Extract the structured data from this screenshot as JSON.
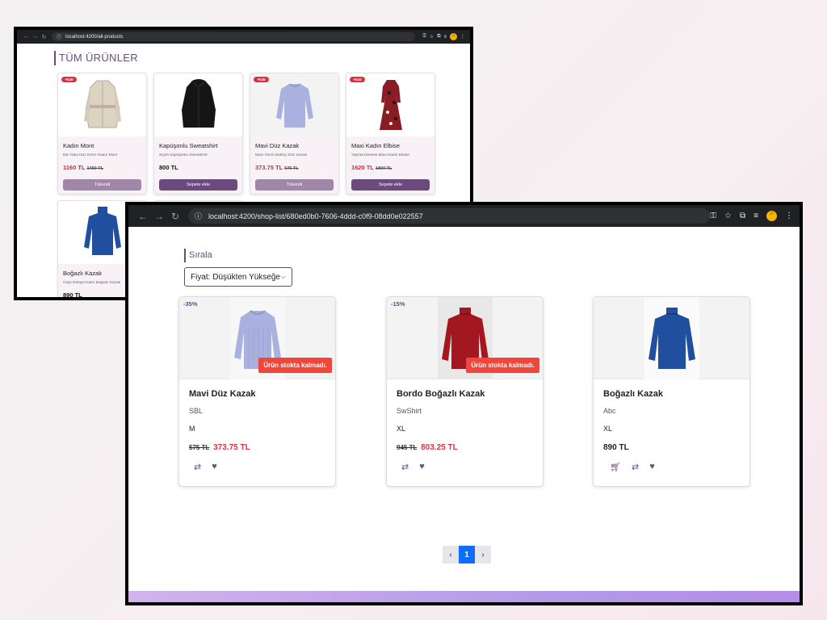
{
  "back_window": {
    "url": "localhost:4200/all-products",
    "heading": "TÜM ÜRÜNLER",
    "products": [
      {
        "badge": "-%20",
        "name": "Kadın Mont",
        "desc": "Dik Yaka Düz Krem Kadın Mont",
        "price": "1160 TL",
        "old_price": "1450 TL",
        "button": "Tükendi",
        "button_state": "out"
      },
      {
        "badge": "",
        "name": "Kapüşonlu Sweatshirt",
        "desc": "Siyah Kapüşonlu Sweatshirt",
        "price": "800 TL",
        "old_price": "",
        "button": "Sepete ekle",
        "button_state": "add"
      },
      {
        "badge": "-%35",
        "name": "Mavi Düz Kazak",
        "desc": "Mavi Yarım Balıkçı Düz Kazak",
        "price": "373.75 TL",
        "old_price": "575 TL",
        "button": "Tükendi",
        "button_state": "out"
      },
      {
        "badge": "-%10",
        "name": "Maxi Kadın Elbise",
        "desc": "Yaprak Desenli Maxi Kadın Elbise",
        "price": "1620 TL",
        "old_price": "1800 TL",
        "button": "Sepete ekle",
        "button_state": "add"
      },
      {
        "badge": "",
        "name": "Boğazlı Kazak",
        "desc": "Örgü Detaylı Kalın Boğazlı Kazak",
        "price": "890 TL",
        "old_price": "",
        "button": "",
        "button_state": ""
      }
    ]
  },
  "front_window": {
    "url": "localhost:4200/shop-list/680ed0b0-7606-4ddd-c0f9-08dd0e022557",
    "sort_label": "Sırala",
    "sort_value": "Fiyat: Düşükten Yükseğe",
    "products": [
      {
        "discount": "-35%",
        "stock_label": "Ürün stokta kalmadı.",
        "name": "Mavi Düz Kazak",
        "brand": "SBL",
        "size": "M",
        "old_price": "575 TL",
        "price": "373.75 TL"
      },
      {
        "discount": "-15%",
        "stock_label": "Ürün stokta kalmadı.",
        "name": "Bordo Boğazlı Kazak",
        "brand": "SwShirt",
        "size": "XL",
        "old_price": "945 TL",
        "price": "803.25 TL"
      },
      {
        "discount": "",
        "stock_label": "",
        "name": "Boğazlı Kazak",
        "brand": "Abc",
        "size": "XL",
        "old_price": "",
        "price": "890 TL"
      }
    ],
    "pagination": {
      "prev": "‹",
      "current": "1",
      "next": "›"
    }
  },
  "colors": {
    "accent": "#6b4a80",
    "sale": "#e03240",
    "out_of_stock": "#f0463c",
    "page_active": "#0d6efd"
  }
}
